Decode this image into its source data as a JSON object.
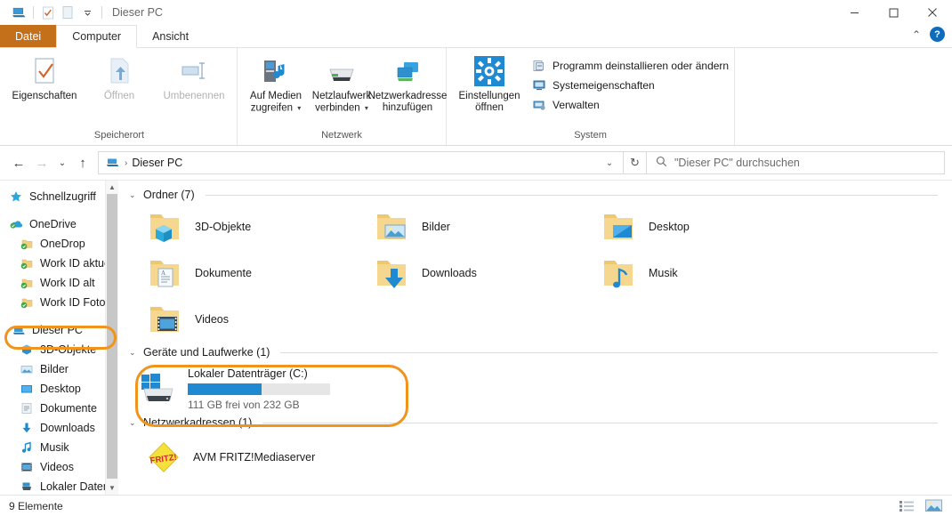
{
  "window": {
    "title": "Dieser PC",
    "quick_access": [
      "pc-icon",
      "properties-icon",
      "new-folder-icon",
      "customize-caret"
    ],
    "controls": {
      "minimize": "minimize-icon",
      "maximize": "maximize-icon",
      "close": "close-icon"
    }
  },
  "tabs": [
    {
      "label": "Datei",
      "state": "file"
    },
    {
      "label": "Computer",
      "state": "active"
    },
    {
      "label": "Ansicht",
      "state": "normal"
    }
  ],
  "ribbon": {
    "collapse_icon": "chevron-up-icon",
    "help_icon": "help-icon",
    "groups": [
      {
        "label": "Speicherort",
        "buttons": [
          {
            "label": "Eigenschaften",
            "icon": "properties-icon",
            "disabled": false
          },
          {
            "label": "Öffnen",
            "icon": "open-icon",
            "disabled": true
          },
          {
            "label": "Umbenennen",
            "icon": "rename-icon",
            "disabled": true
          }
        ]
      },
      {
        "label": "Netzwerk",
        "buttons": [
          {
            "label": "Auf Medien zugreifen",
            "icon": "media-icon",
            "disabled": false,
            "caret": true
          },
          {
            "label": "Netzlaufwerk verbinden",
            "icon": "map-drive-icon",
            "disabled": false,
            "caret": true
          },
          {
            "label": "Netzwerkadresse hinzufügen",
            "icon": "add-network-icon",
            "disabled": false,
            "caret": false
          }
        ]
      },
      {
        "label": "System",
        "big_button": {
          "label": "Einstellungen öffnen",
          "icon": "settings-gear-icon"
        },
        "small_buttons": [
          {
            "label": "Programm deinstallieren oder ändern",
            "icon": "uninstall-icon"
          },
          {
            "label": "Systemeigenschaften",
            "icon": "system-properties-icon"
          },
          {
            "label": "Verwalten",
            "icon": "manage-icon"
          }
        ]
      }
    ]
  },
  "navigation": {
    "back": "back-arrow-icon",
    "forward": "forward-arrow-icon",
    "recent": "chevron-down-icon",
    "up": "up-arrow-icon",
    "breadcrumb": {
      "icon": "this-pc-icon",
      "text": "Dieser PC",
      "separator": "›"
    },
    "address_dropdown": "chevron-down-icon",
    "refresh": "refresh-icon",
    "search": {
      "icon": "search-icon",
      "placeholder": "\"Dieser PC\" durchsuchen",
      "value": ""
    }
  },
  "sidebar": {
    "items": [
      {
        "label": "Schnellzugriff",
        "icon": "star-icon",
        "level": 0,
        "selected": false
      },
      {
        "label": "OneDrive",
        "icon": "onedrive-cloud-icon",
        "level": 0,
        "selected": false
      },
      {
        "label": "OneDrop",
        "icon": "folder-synced-icon",
        "level": 1,
        "selected": false
      },
      {
        "label": "Work ID aktuell",
        "icon": "folder-synced-icon",
        "level": 1,
        "selected": false
      },
      {
        "label": "Work ID alt",
        "icon": "folder-synced-icon",
        "level": 1,
        "selected": false
      },
      {
        "label": "Work ID Fotos",
        "icon": "folder-synced-icon",
        "level": 1,
        "selected": false
      },
      {
        "label": "Dieser PC",
        "icon": "this-pc-icon",
        "level": 0,
        "selected": true
      },
      {
        "label": "3D-Objekte",
        "icon": "3d-objects-icon",
        "level": 1,
        "selected": false
      },
      {
        "label": "Bilder",
        "icon": "pictures-icon",
        "level": 1,
        "selected": false
      },
      {
        "label": "Desktop",
        "icon": "desktop-icon",
        "level": 1,
        "selected": false
      },
      {
        "label": "Dokumente",
        "icon": "documents-icon",
        "level": 1,
        "selected": false
      },
      {
        "label": "Downloads",
        "icon": "downloads-icon",
        "level": 1,
        "selected": false
      },
      {
        "label": "Musik",
        "icon": "music-icon",
        "level": 1,
        "selected": false
      },
      {
        "label": "Videos",
        "icon": "videos-icon",
        "level": 1,
        "selected": false
      },
      {
        "label": "Lokaler Datenträ",
        "icon": "drive-icon",
        "level": 1,
        "selected": false
      }
    ],
    "scrollbar": {
      "up": "scroll-up-icon",
      "down": "scroll-down-icon"
    }
  },
  "main": {
    "sections": [
      {
        "title": "Ordner (7)",
        "chevron": "chevron-down-icon"
      },
      {
        "title": "Geräte und Laufwerke (1)",
        "chevron": "chevron-down-icon"
      },
      {
        "title": "Netzwerkadressen (1)",
        "chevron": "chevron-down-icon"
      }
    ],
    "folders": [
      {
        "label": "3D-Objekte",
        "icon": "folder-3d-icon"
      },
      {
        "label": "Bilder",
        "icon": "folder-pictures-icon"
      },
      {
        "label": "Desktop",
        "icon": "folder-desktop-icon"
      },
      {
        "label": "Dokumente",
        "icon": "folder-documents-icon"
      },
      {
        "label": "Downloads",
        "icon": "folder-downloads-icon"
      },
      {
        "label": "Musik",
        "icon": "folder-music-icon"
      },
      {
        "label": "Videos",
        "icon": "folder-videos-icon"
      }
    ],
    "drives": [
      {
        "name": "Lokaler Datenträger (C:)",
        "icon": "windows-drive-icon",
        "free_text": "111 GB frei von 232 GB",
        "used_percent": 52,
        "bar_color": "#1f8ad2"
      }
    ],
    "network_locations": [
      {
        "label": "AVM FRITZ!Mediaserver",
        "icon": "fritz-icon"
      }
    ]
  },
  "statusbar": {
    "count_text": "9 Elemente",
    "views": [
      {
        "name": "details-view-button",
        "icon": "details-view-icon"
      },
      {
        "name": "large-icons-view-button",
        "icon": "large-icons-view-icon"
      }
    ]
  },
  "highlights": {
    "color": "#f0941e",
    "targets": [
      "sidebar-item-dieser-pc",
      "drive-tile-c"
    ]
  }
}
